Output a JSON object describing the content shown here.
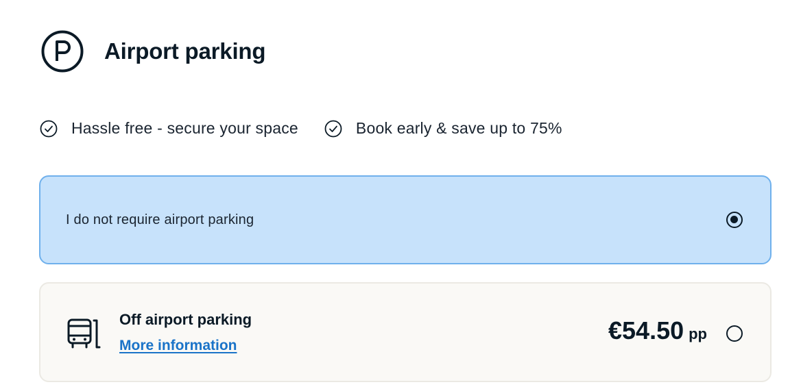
{
  "header": {
    "icon": "parking-icon",
    "title": "Airport parking"
  },
  "benefits": [
    {
      "icon": "check-circle-icon",
      "text": "Hassle free - secure your space"
    },
    {
      "icon": "check-circle-icon",
      "text": "Book early & save up to 75%"
    }
  ],
  "options": {
    "none": {
      "label": "I do not require airport parking",
      "selected": true
    },
    "off_airport": {
      "icon": "shuttle-bus-icon",
      "title": "Off airport parking",
      "link": "More information",
      "price": "€54.50",
      "price_unit": "pp",
      "selected": false
    }
  },
  "colors": {
    "selected_bg": "#c7e2fb",
    "selected_border": "#6fb0ec",
    "card_bg": "#faf9f6",
    "link": "#1a73c8",
    "text": "#0b1a26"
  }
}
